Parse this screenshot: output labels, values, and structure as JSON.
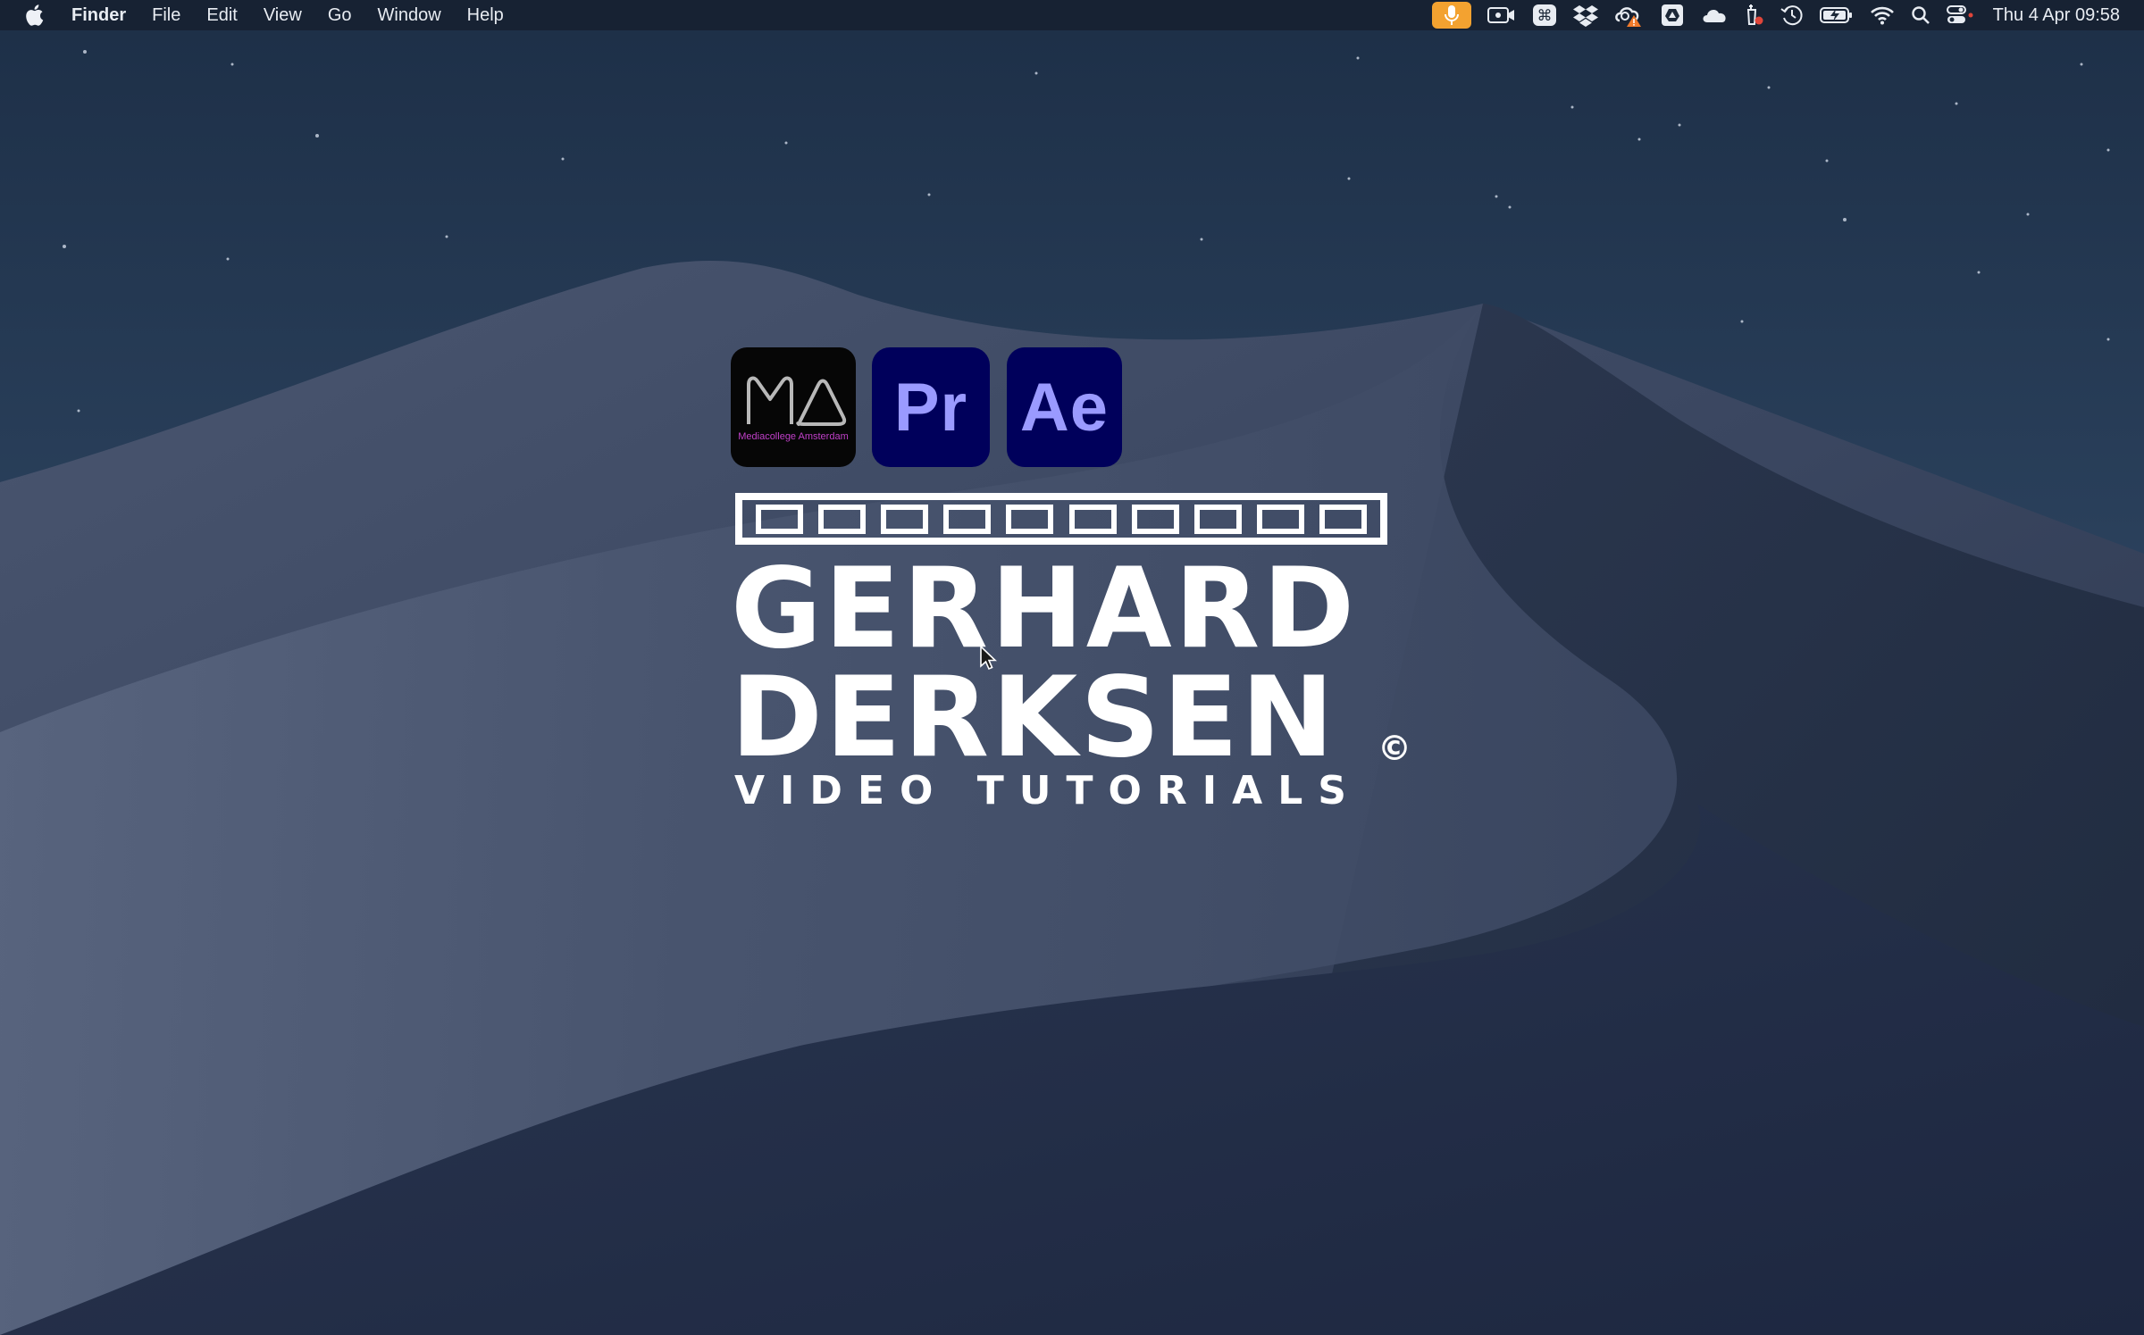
{
  "menubar": {
    "app_name": "Finder",
    "menus": [
      "File",
      "Edit",
      "View",
      "Go",
      "Window",
      "Help"
    ],
    "status_icons": [
      "microphone-icon",
      "screen-record-icon",
      "command-key-icon",
      "dropbox-icon",
      "creative-cloud-sync-icon",
      "google-drive-icon",
      "icloud-icon",
      "memory-cleaner-icon",
      "time-machine-icon",
      "battery-charging-icon",
      "wifi-icon",
      "spotlight-search-icon",
      "control-center-icon"
    ],
    "clock": "Thu 4 Apr  09:58",
    "mic_color": "#f3a230"
  },
  "desktop": {
    "app_icons": {
      "ma_caption": "Mediacollege Amsterdam",
      "premiere_label": "Pr",
      "after_effects_label": "Ae"
    },
    "logo": {
      "line1": "GERHARD",
      "line2": "DERKSEN",
      "copyright": "©",
      "line3": "VIDEO TUTORIALS"
    }
  },
  "colors": {
    "adobe_bg": "#00005b",
    "adobe_text": "#9a9aff",
    "ma_accent": "#c040c8"
  }
}
